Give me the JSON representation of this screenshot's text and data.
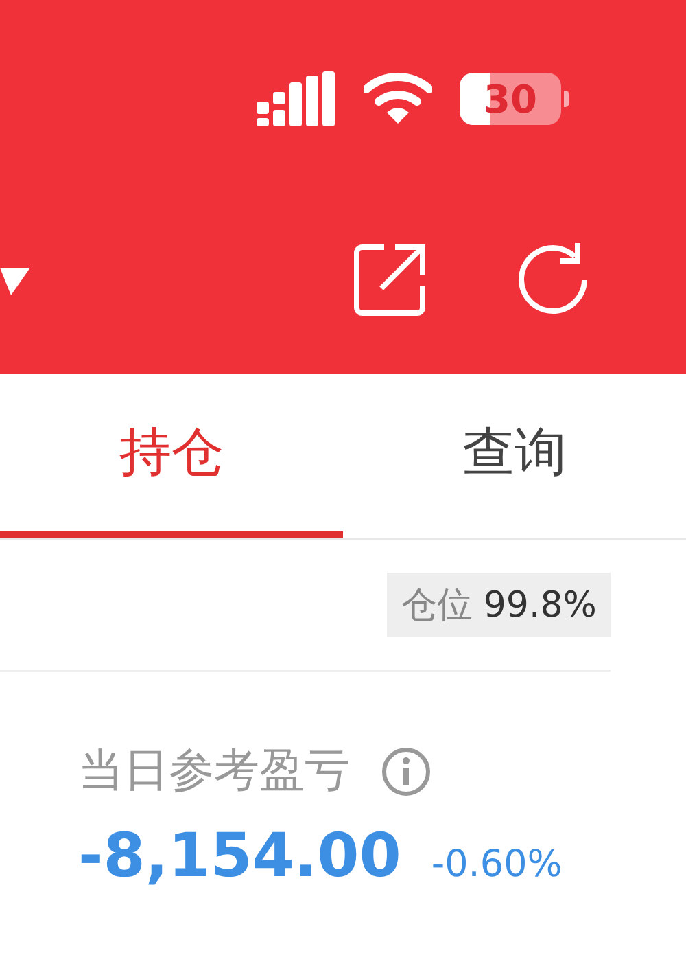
{
  "status_bar": {
    "battery": "30"
  },
  "tabs": [
    {
      "label": "持仓",
      "selected": true
    },
    {
      "label": "查询",
      "selected": false
    }
  ],
  "position_badge": {
    "label": "仓位",
    "value": "99.8%"
  },
  "daily_pnl": {
    "label": "当日参考盈亏",
    "amount": "-8,154.00",
    "percent": "-0.60%"
  }
}
